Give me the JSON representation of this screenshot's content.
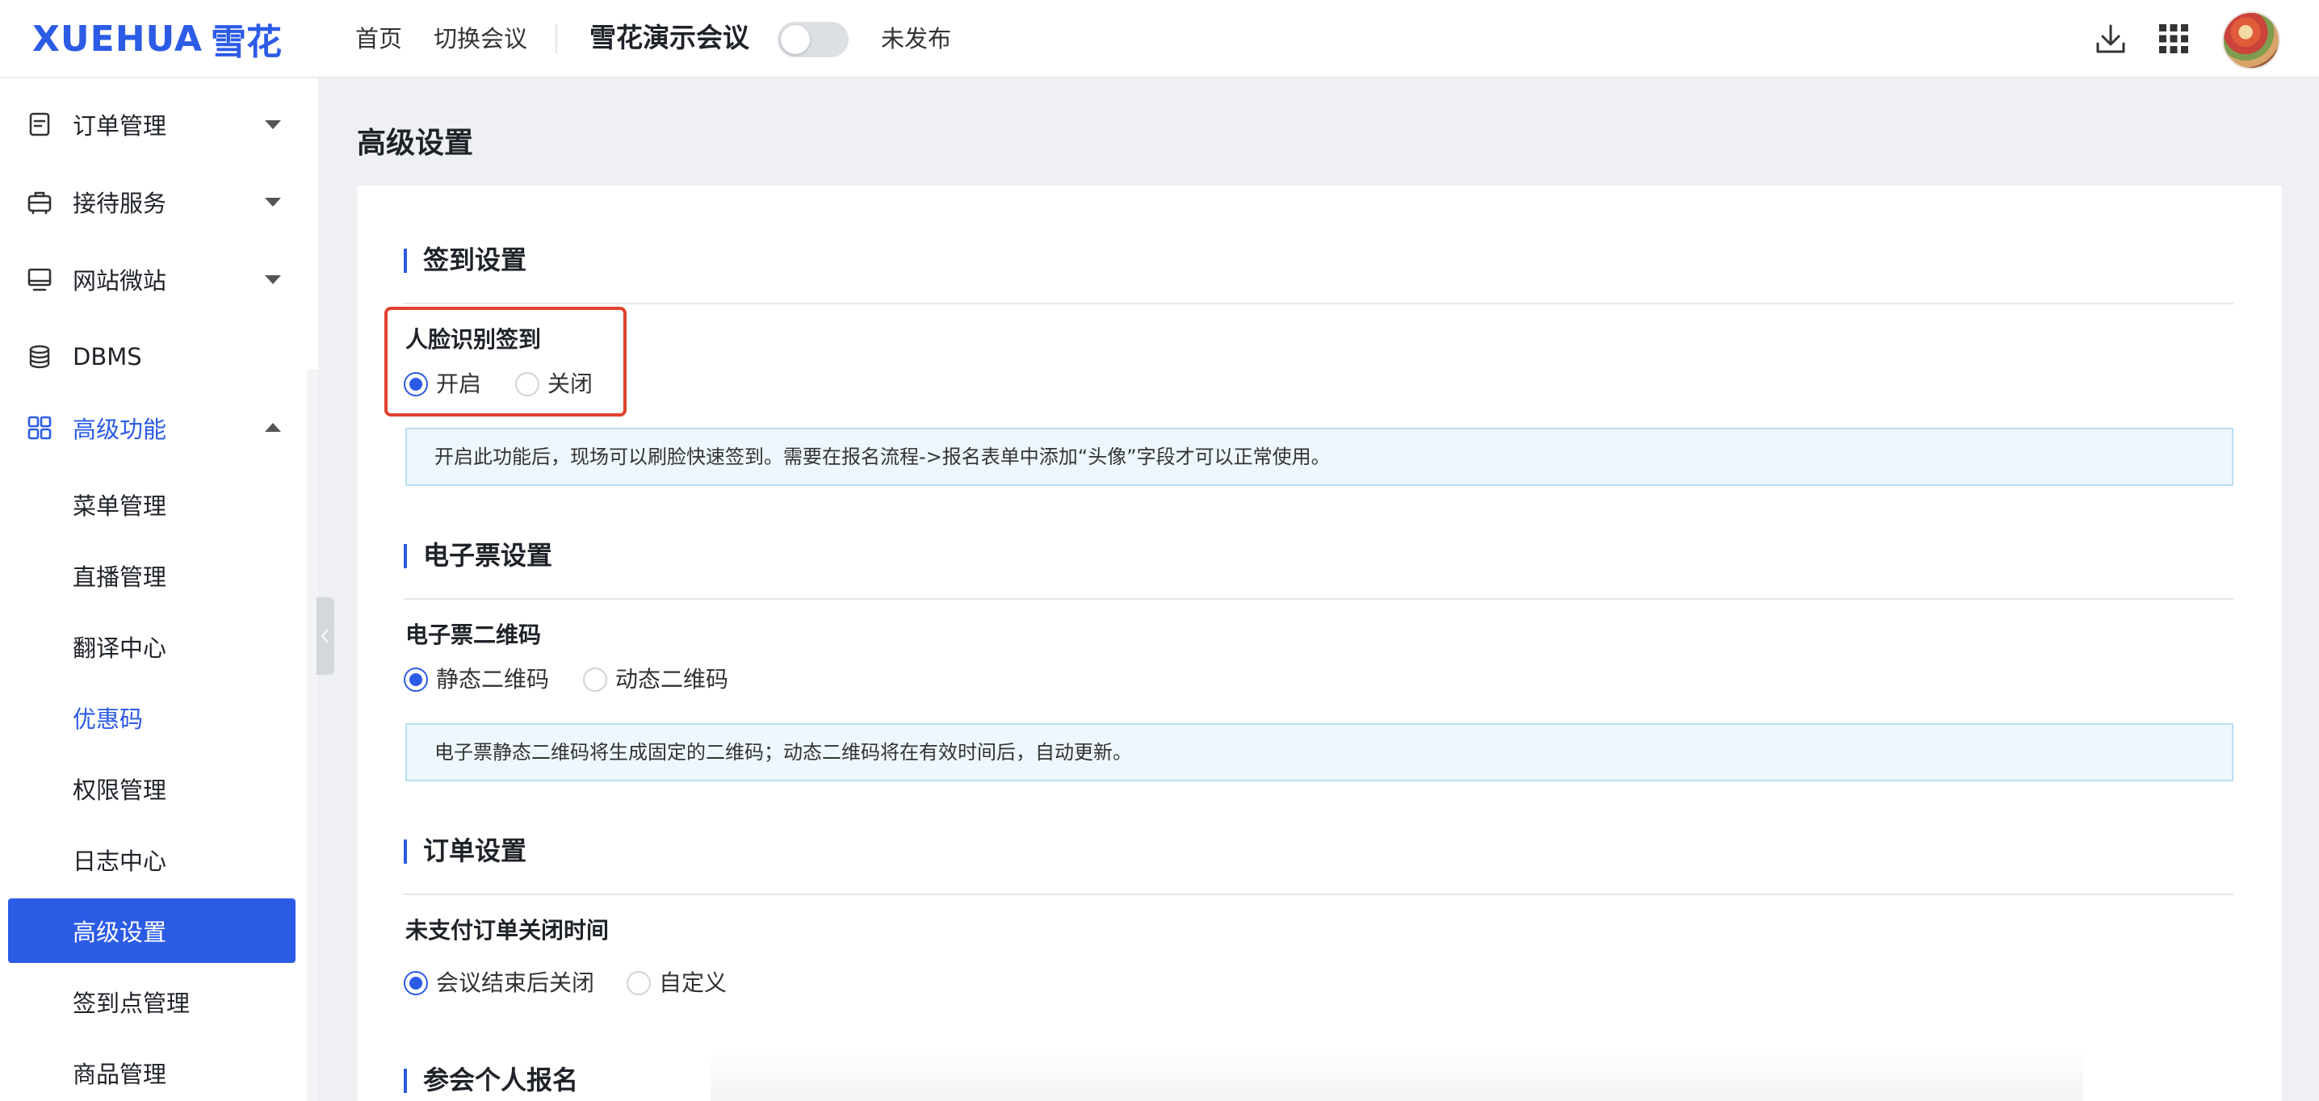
{
  "header": {
    "logo_latin": "XUEHUA",
    "logo_cjk": "雪花",
    "nav": [
      "首页",
      "切换会议"
    ],
    "meeting_name": "雪花演示会议",
    "publish_toggle_on": false,
    "publish_status": "未发布",
    "icons": [
      "download-icon",
      "apps-grid-icon"
    ]
  },
  "sidebar": {
    "groups": [
      {
        "label": "订单管理",
        "icon": "document-icon",
        "expanded": false
      },
      {
        "label": "接待服务",
        "icon": "suitcase-icon",
        "expanded": false
      },
      {
        "label": "网站微站",
        "icon": "monitor-icon",
        "expanded": false
      },
      {
        "label": "DBMS",
        "icon": "database-icon"
      },
      {
        "label": "高级功能",
        "icon": "grid-icon",
        "expanded": true
      }
    ],
    "sub_items": [
      {
        "label": "菜单管理"
      },
      {
        "label": "直播管理"
      },
      {
        "label": "翻译中心"
      },
      {
        "label": "优惠码"
      },
      {
        "label": "权限管理"
      },
      {
        "label": "日志中心"
      },
      {
        "label": "高级设置",
        "selected": true
      },
      {
        "label": "签到点管理"
      },
      {
        "label": "商品管理"
      }
    ]
  },
  "main": {
    "page_title": "高级设置",
    "sections": [
      {
        "title": "签到设置",
        "field_label": "人脸识别签到",
        "options": [
          "开启",
          "关闭"
        ],
        "selected": "开启",
        "tip": "开启此功能后，现场可以刷脸快速签到。需要在报名流程->报名表单中添加“头像”字段才可以正常使用。"
      },
      {
        "title": "电子票设置",
        "field_label": "电子票二维码",
        "options": [
          "静态二维码",
          "动态二维码"
        ],
        "selected": "静态二维码",
        "tip": "电子票静态二维码将生成固定的二维码；动态二维码将在有效时间后，自动更新。"
      },
      {
        "title": "订单设置",
        "field_label": "未支付订单关闭时间",
        "options": [
          "会议结束后关闭",
          "自定义"
        ],
        "selected": "会议结束后关闭"
      },
      {
        "title": "参会个人报名"
      }
    ]
  },
  "colors": {
    "accent": "#2c5be6",
    "highlight_border": "#e0412e",
    "tip_background": "#eef7fd",
    "tip_border": "#b9dff3",
    "page_background": "#eef0f3"
  }
}
